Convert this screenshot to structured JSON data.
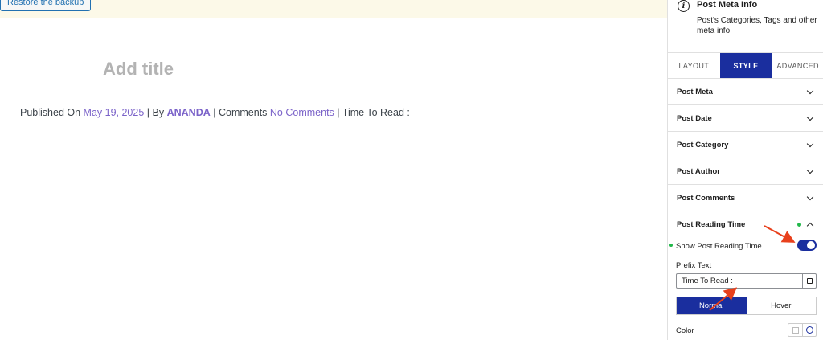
{
  "canvas": {
    "restore_button": "Restore the backup",
    "title_placeholder": "Add title",
    "meta": {
      "published_prefix": "Published On",
      "date": "May 19, 2025",
      "sep1": "|",
      "by": "By",
      "author": "ANANDA",
      "sep2": "|",
      "comments_label": "Comments",
      "comments_link": "No Comments",
      "sep3": "|",
      "read_label": "Time To Read :"
    }
  },
  "sidebar": {
    "block": {
      "icon": "info-icon",
      "title": "Post Meta Info",
      "description": "Post's Categories, Tags and other meta info"
    },
    "tabs": [
      {
        "label": "LAYOUT",
        "active": false
      },
      {
        "label": "STYLE",
        "active": true
      },
      {
        "label": "ADVANCED",
        "active": false
      }
    ],
    "panels": [
      {
        "label": "Post Meta"
      },
      {
        "label": "Post Date"
      },
      {
        "label": "Post Category"
      },
      {
        "label": "Post Author"
      },
      {
        "label": "Post Comments"
      }
    ],
    "reading_time": {
      "label": "Post Reading Time",
      "show_label": "Show Post Reading Time",
      "show_enabled": true,
      "prefix_label": "Prefix Text",
      "prefix_value": "Time To Read :",
      "state_tabs": [
        "Normal",
        "Hover"
      ],
      "color_label": "Color"
    },
    "colors": {
      "accent": "#1a2e9e",
      "modified_dot": "#22b84a",
      "annotation": "#e8401c"
    }
  }
}
